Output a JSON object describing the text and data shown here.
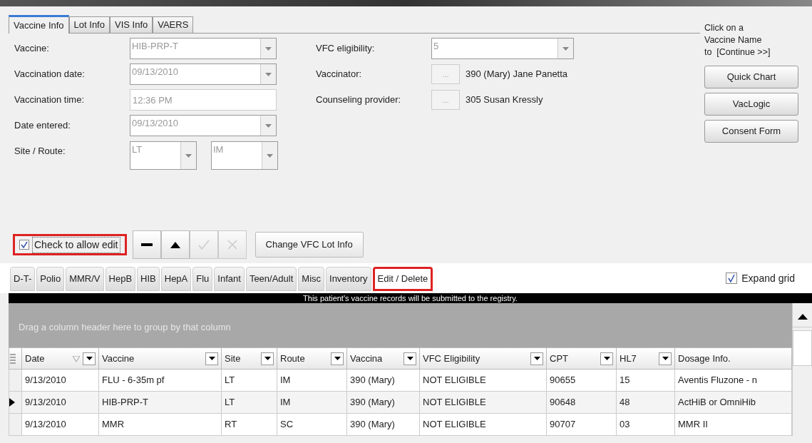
{
  "tabs": [
    {
      "label": "Vaccine Info",
      "selected": true
    },
    {
      "label": "Lot Info",
      "selected": false
    },
    {
      "label": "VIS Info",
      "selected": false
    },
    {
      "label": "VAERS",
      "selected": false
    }
  ],
  "form_left": [
    {
      "label": "Vaccine:",
      "kind": "dropdown",
      "value": "HIB-PRP-T",
      "disabled": true
    },
    {
      "label": "Vaccination date:",
      "kind": "dropdown",
      "value": "09/13/2010",
      "disabled": true
    },
    {
      "label": "Vaccination time:",
      "kind": "text",
      "value": "12:36 PM",
      "disabled": true
    },
    {
      "label": "Date entered:",
      "kind": "dropdown",
      "value": "09/13/2010",
      "disabled": true
    },
    {
      "label": "Site / Route:",
      "kind": "pair",
      "values": [
        "LT",
        "IM"
      ],
      "disabled": true
    }
  ],
  "form_right": [
    {
      "label": "VFC eligibility:",
      "kind": "dropdown",
      "value": "5",
      "disabled": true
    },
    {
      "label": "Vaccinator:",
      "kind": "picker",
      "button": "...",
      "value": "390 (Mary) Jane Panetta"
    },
    {
      "label": "Counseling provider:",
      "kind": "picker",
      "button": "...",
      "value": "305 Susan Kressly"
    }
  ],
  "hint": [
    "Click on a",
    "Vaccine Name",
    "to  [Continue >>]"
  ],
  "side_buttons": [
    "Quick Chart",
    "VacLogic",
    "Consent Form"
  ],
  "allow_edit": {
    "label": "Check to allow edit",
    "checked": true,
    "highlighted": true
  },
  "toolbar": [
    {
      "kind": "minus",
      "disabled": false
    },
    {
      "kind": "up",
      "disabled": false
    },
    {
      "kind": "check",
      "disabled": true
    },
    {
      "kind": "cross",
      "disabled": true
    }
  ],
  "change_lot_button": "Change VFC Lot Info",
  "category_tabs": [
    {
      "label": "D-T-",
      "highlighted": false
    },
    {
      "label": "Polio",
      "highlighted": false
    },
    {
      "label": "MMR/V",
      "highlighted": false
    },
    {
      "label": "HepB",
      "highlighted": false
    },
    {
      "label": "HIB",
      "highlighted": false
    },
    {
      "label": "HepA",
      "highlighted": false
    },
    {
      "label": "Flu",
      "highlighted": false
    },
    {
      "label": "Infant",
      "highlighted": false
    },
    {
      "label": "Teen/Adult",
      "highlighted": false
    },
    {
      "label": "Misc",
      "highlighted": false
    },
    {
      "label": "Inventory",
      "highlighted": false
    },
    {
      "label": "Edit / Delete",
      "highlighted": true
    }
  ],
  "expand_grid": {
    "label": "Expand grid",
    "checked": true
  },
  "registry_banner": "This patient's vaccine records will be submitted to the registry.",
  "group_hint": "Drag a column header here to group by that column",
  "table": {
    "columns": [
      {
        "label": "Date",
        "sorted": true
      },
      {
        "label": "Vaccine",
        "sorted": false
      },
      {
        "label": "Site",
        "sorted": false
      },
      {
        "label": "Route",
        "sorted": false
      },
      {
        "label": "Vaccina",
        "sorted": false
      },
      {
        "label": "VFC Eligibility",
        "sorted": false
      },
      {
        "label": "CPT",
        "sorted": false
      },
      {
        "label": "HL7",
        "sorted": false
      },
      {
        "label": "Dosage Info.",
        "sorted": false
      }
    ],
    "rows": [
      {
        "selected": false,
        "cells": [
          "9/13/2010",
          "FLU - 6-35m pf",
          "LT",
          "IM",
          "390 (Mary)",
          "NOT ELIGIBLE",
          "90655",
          "15",
          "Aventis Fluzone - n"
        ]
      },
      {
        "selected": true,
        "cells": [
          "9/13/2010",
          "HIB-PRP-T",
          "LT",
          "IM",
          "390 (Mary)",
          "NOT ELIGIBLE",
          "90648",
          "48",
          "ActHiB or OmniHib"
        ]
      },
      {
        "selected": false,
        "cells": [
          "9/13/2010",
          "MMR",
          "RT",
          "SC",
          "390 (Mary)",
          "NOT ELIGIBLE",
          "90707",
          "03",
          "MMR II"
        ]
      }
    ]
  }
}
